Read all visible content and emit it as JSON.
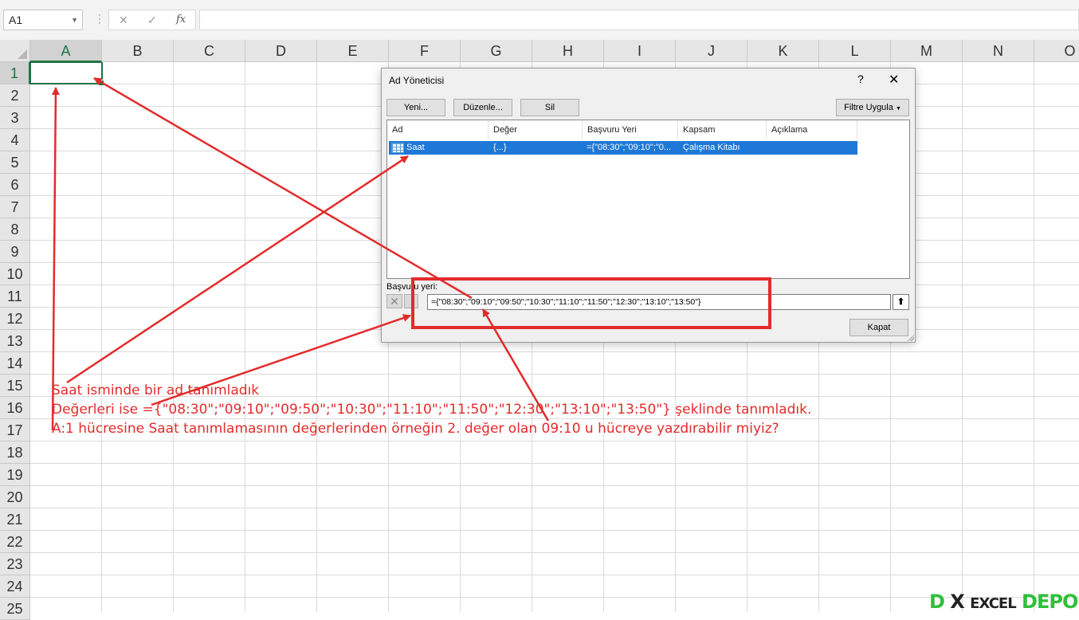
{
  "formula_bar": {
    "name_box": "A1",
    "cancel_glyph": "✕",
    "enter_glyph": "✓",
    "fx_label": "fx",
    "formula": ""
  },
  "sheet": {
    "columns": [
      "A",
      "B",
      "C",
      "D",
      "E",
      "F",
      "G",
      "H",
      "I",
      "J",
      "K",
      "L",
      "M",
      "N",
      "O"
    ],
    "rows": [
      "1",
      "2",
      "3",
      "4",
      "5",
      "6",
      "7",
      "8",
      "9",
      "10",
      "11",
      "12",
      "13",
      "14",
      "15",
      "16",
      "17",
      "18",
      "19",
      "20",
      "21",
      "22",
      "23",
      "24",
      "25"
    ],
    "active_cell": "A1"
  },
  "dialog": {
    "title": "Ad Yöneticisi",
    "help": "?",
    "close": "✕",
    "buttons": {
      "new": "Yeni...",
      "edit": "Düzenle...",
      "delete": "Sil",
      "filter": "Filtre Uygula",
      "close": "Kapat"
    },
    "list": {
      "headers": [
        "Ad",
        "Değer",
        "Başvuru Yeri",
        "Kapsam",
        "Açıklama"
      ],
      "rows": [
        {
          "name": "Saat",
          "value": "{...}",
          "refers_to": "={\"08:30\";\"09:10\";\"0...",
          "scope": "Çalışma Kitabı",
          "comment": ""
        }
      ]
    },
    "refers_to_label": "Başvuru yeri:",
    "refers_to_value": "={\"08:30\";\"09:10\";\"09:50\";\"10:30\";\"11:10\";\"11:50\";\"12:30\";\"13:10\";\"13:50\"}",
    "collapse_glyph": "⬆"
  },
  "annotations": {
    "line1": "Saat isminde bir ad tanımladık",
    "line2": "Değerleri ise ={\"08:30\";\"09:10\";\"09:50\";\"10:30\";\"11:10\";\"11:50\";\"12:30\";\"13:10\";\"13:50\"} şeklinde tanımladık.",
    "line3": "A:1 hücresine Saat tanımlamasının değerlerinden örneğin 2. değer olan 09:10 u hücreye yazdırabilir miyiz?",
    "color": "#e32b2b"
  },
  "watermark": {
    "part1": "D",
    "part2": "X",
    "part3": "EXCEL",
    "part4": "DEPO"
  },
  "colors": {
    "excel_green": "#217346",
    "selection_blue": "#1e78d8"
  }
}
